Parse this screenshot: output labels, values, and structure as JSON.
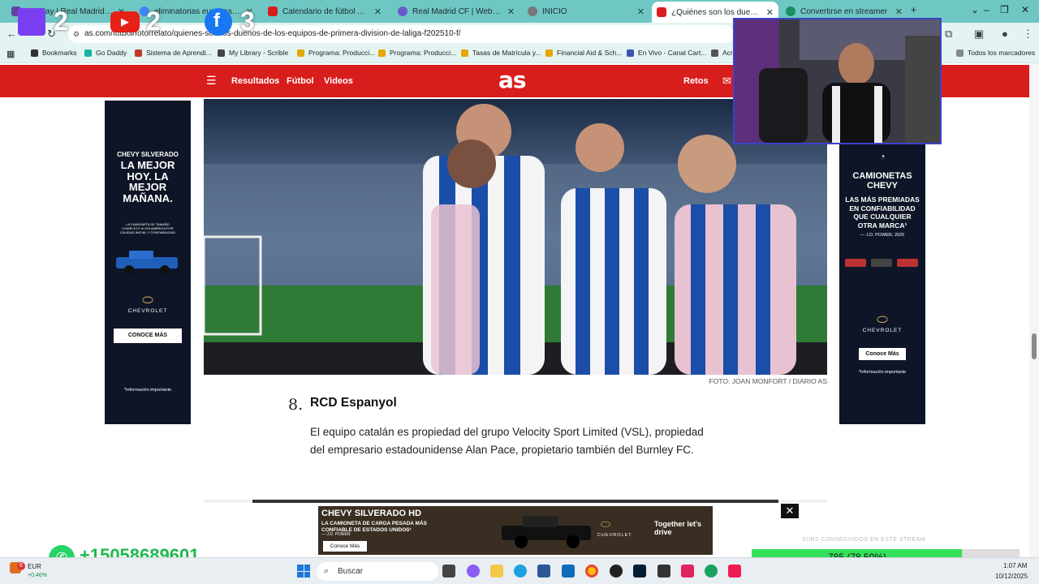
{
  "tabs": [
    {
      "label": "(1) Play | Real Madrid's stream",
      "color": "#6441a5"
    },
    {
      "label": "eliminatorias europeas - Buscar",
      "color": "#4285f4"
    },
    {
      "label": "Calendario de fútbol Amistosos",
      "color": "#d81d1d"
    },
    {
      "label": "Real Madrid CF | Web Oficial",
      "color": "#6a5acd"
    },
    {
      "label": "INICIO",
      "color": "#777777"
    },
    {
      "label": "¿Quiénes son los dueños de los",
      "color": "#d81d1d"
    },
    {
      "label": "Convertirse en streamer",
      "color": "#1a8f5f"
    }
  ],
  "window_controls": [
    "+",
    "⌄",
    "–",
    "❐",
    "✕"
  ],
  "url": "as.com/futbol/fotorrelato/quienes-son-los-duenos-de-los-equipos-de-primera-division-de-laliga-f202510-f/",
  "bookmarks": [
    {
      "label": "Bookmarks",
      "color": "#333333"
    },
    {
      "label": "Go Daddy",
      "color": "#1bb3a4"
    },
    {
      "label": "Sistema de Aprendi...",
      "color": "#c0392b"
    },
    {
      "label": "My Library - Scrible",
      "color": "#444444"
    },
    {
      "label": "Programa: Producci...",
      "color": "#e6a700"
    },
    {
      "label": "Programa: Producci...",
      "color": "#e6a700"
    },
    {
      "label": "Tasas de Matrícula y...",
      "color": "#e6a700"
    },
    {
      "label": "Financial Aid & Sch...",
      "color": "#e6a700"
    },
    {
      "label": "En Vivo - Canal Cart...",
      "color": "#3f51b5"
    },
    {
      "label": "Acre",
      "color": "#555555"
    }
  ],
  "all_bookmarks": "Todos los marcadores",
  "site": {
    "logo": "as",
    "nav": {
      "results": "Resultados",
      "football": "Fútbol",
      "videos": "Videos",
      "challenges": "Retos"
    }
  },
  "left_ad": {
    "brand_line": "CHEVY SILVERADO",
    "head": "LA MEJOR HOY. LA MEJOR MAÑANA.",
    "small": "LA CAMIONETA DE TAMAÑO COMPLETO #1 EN AMÉRICA POR CALIDAD INICIAL Y CONFIABILIDAD",
    "brand": "CHEVROLET",
    "cta": "CONOCE MÁS",
    "footnote": "*Información importante"
  },
  "right_ad": {
    "head": "CAMIONETAS CHEVY",
    "sub": "LAS MÁS PREMIADAS EN CONFIABILIDAD QUE CUALQUIER OTRA MARCA¹",
    "source": "— J.D. POWER, 2025",
    "brand": "CHEVROLET",
    "cta": "Conoce Más",
    "footnote": "*Información importante"
  },
  "photo_caption": "FOTO: JOAN MONFORT / DIARIO AS",
  "article": {
    "number": "8.",
    "team": "RCD Espanyol",
    "text": "El equipo catalán es propiedad del grupo Velocity Sport Limited (VSL), propiedad del empresario estadounidense Alan Pace, propietario también del Burnley FC."
  },
  "bottom_ad": {
    "head": "CHEVY SILVERADO HD",
    "sub": "LA CAMIONETA DE CARGA PESADA MÁS CONFIABLE DE ESTADOS UNIDOS¹",
    "source": "— J.D. POWER",
    "cta": "Conoce Más",
    "brand": "CHEVROLET",
    "tagline": "Together let's drive",
    "close": "✕"
  },
  "stream_overlay": {
    "twitch_count": "2",
    "youtube_count": "2",
    "facebook_count": "3",
    "whatsapp": "+15058689601",
    "progress_text": "785 (78.50%)",
    "progress_fraction": 0.785,
    "ticker": "SUBS CONSEGUIDOS EN ESTE STREAM"
  },
  "taskbar": {
    "search_placeholder": "Buscar",
    "stock_label": "EUR",
    "stock_change": "+0.46%",
    "notif_count": "6",
    "time": "1:07 AM",
    "date": "10/12/2025"
  },
  "colors": {
    "tabstrip": "#6fc7c4",
    "brand_red": "#d81d1d",
    "ad_navy": "#0e1526"
  }
}
